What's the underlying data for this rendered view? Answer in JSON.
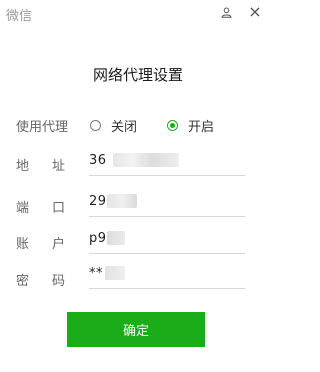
{
  "app": {
    "title": "微信"
  },
  "titlebar": {
    "user_icon": "user-icon",
    "close_icon": "close-icon",
    "close_glyph": "×"
  },
  "dialog": {
    "title": "网络代理设置",
    "proxy_label": "使用代理",
    "options": [
      {
        "label": "关闭",
        "selected": false
      },
      {
        "label": "开启",
        "selected": true
      }
    ],
    "fields": {
      "address": {
        "label": "地址",
        "value": "36"
      },
      "port": {
        "label": "端口",
        "value": "29"
      },
      "account": {
        "label": "账户",
        "value": "p9"
      },
      "password": {
        "label": "密码",
        "value": "**"
      }
    },
    "confirm_label": "确定"
  },
  "colors": {
    "accent": "#1aad19",
    "muted_text": "#9a9a9a",
    "input_border": "#d6d6d6"
  }
}
